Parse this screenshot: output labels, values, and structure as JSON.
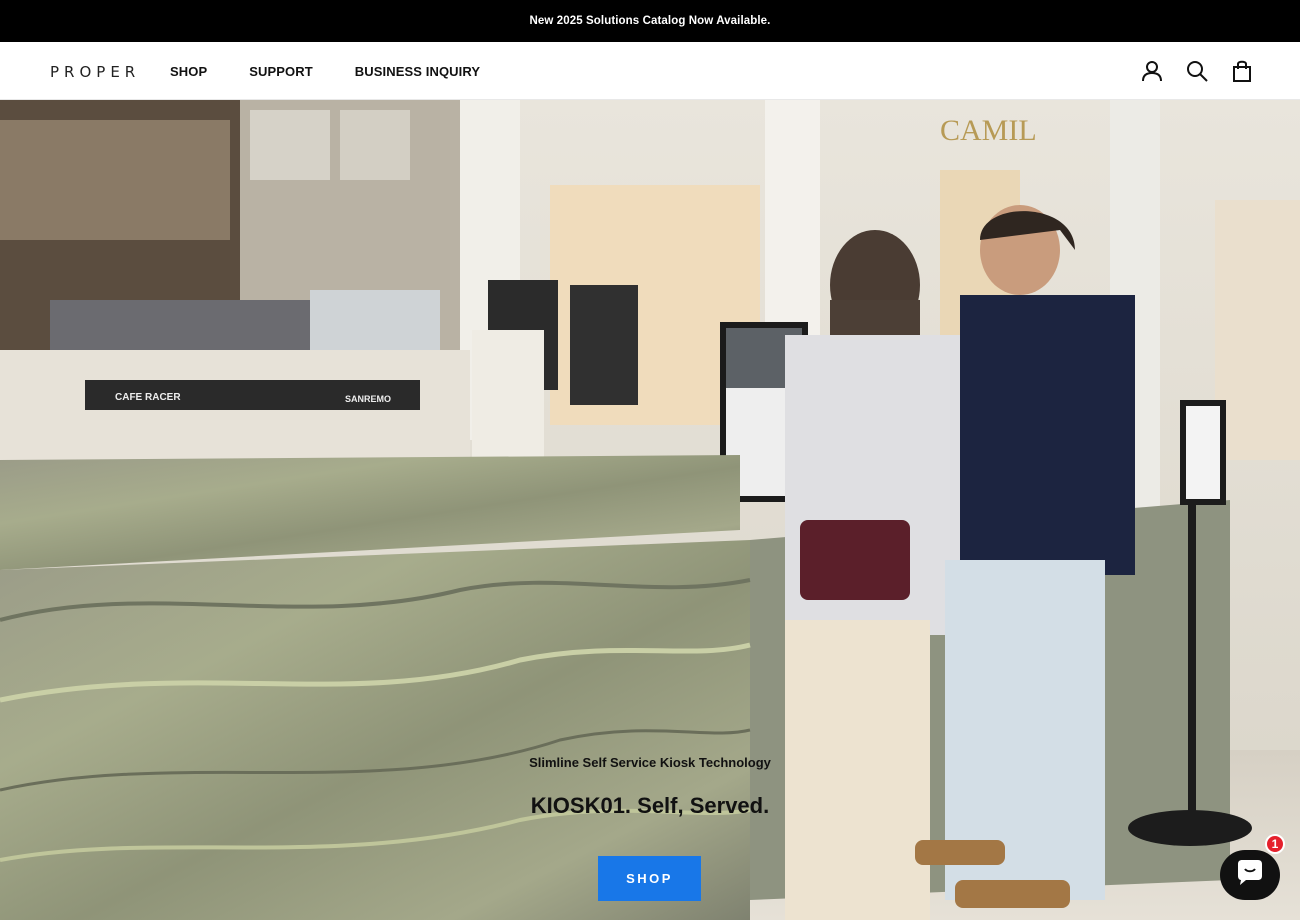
{
  "announcement": {
    "text": "New 2025 Solutions Catalog Now Available."
  },
  "header": {
    "logo": "PROPER",
    "nav": [
      {
        "label": "SHOP"
      },
      {
        "label": "SUPPORT"
      },
      {
        "label": "BUSINESS INQUIRY"
      }
    ],
    "icons": [
      "account-icon",
      "search-icon",
      "cart-icon"
    ]
  },
  "hero": {
    "subtitle": "Slimline Self Service Kiosk Technology",
    "headline": "KIOSK01. Self, Served.",
    "cta_label": "SHOP",
    "cta_color": "#1877e8"
  },
  "chat": {
    "icon": "chat-bubble-icon",
    "badge_count": "1",
    "badge_color": "#e5202c"
  }
}
